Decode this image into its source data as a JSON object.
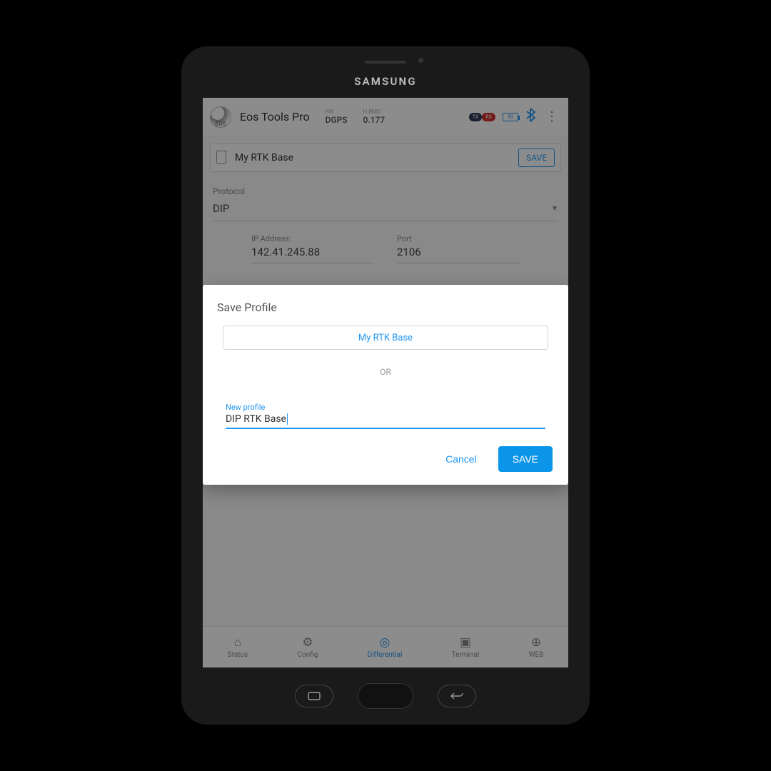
{
  "device": {
    "brand": "SAMSUNG"
  },
  "header": {
    "app_title": "Eos Tools Pro",
    "fix_label": "FIX",
    "fix_value": "DGPS",
    "hrms_label": "H RMS",
    "hrms_value": "0.177",
    "tx": "TX",
    "rx": "RX",
    "battery": "90"
  },
  "profile_bar": {
    "name": "My RTK Base",
    "save": "SAVE"
  },
  "form": {
    "protocol_label": "Protocol",
    "protocol_value": "DIP",
    "ip_label": "IP Address:",
    "ip_value": "142.41.245.88",
    "port_label": "Port",
    "port_value": "2106"
  },
  "dialog": {
    "title": "Save Profile",
    "existing": "My RTK Base",
    "or": "OR",
    "new_label": "New profile",
    "new_value": "DIP RTK Base",
    "cancel": "Cancel",
    "save": "SAVE"
  },
  "nav": {
    "status": "Status",
    "config": "Config",
    "differential": "Differential",
    "terminal": "Terminal",
    "web": "WEB"
  }
}
